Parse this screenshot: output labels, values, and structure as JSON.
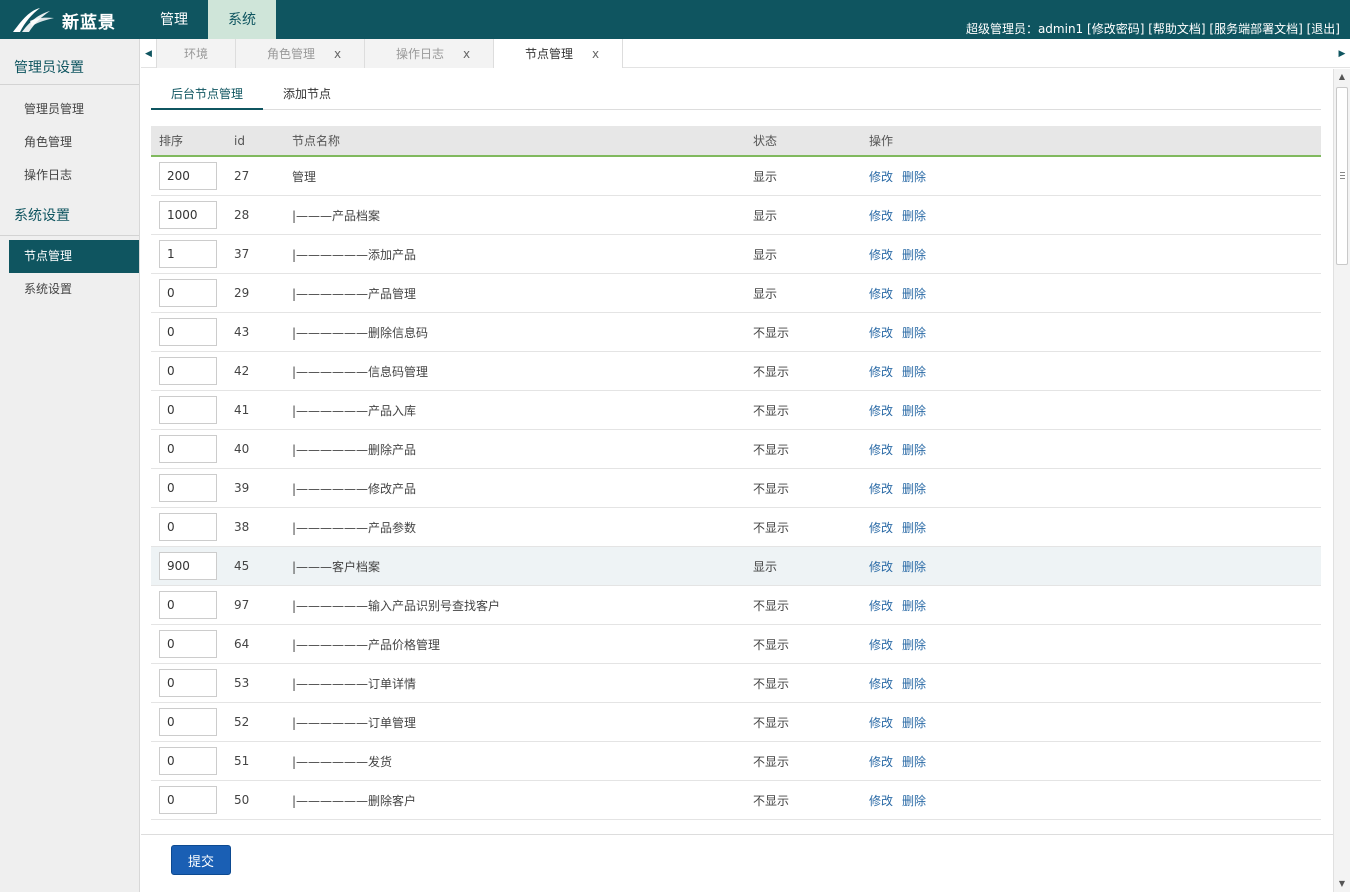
{
  "app": {
    "logo_text": "新蓝景",
    "top_nav": [
      {
        "label": "管理",
        "active": false
      },
      {
        "label": "系统",
        "active": true
      }
    ],
    "user_prefix": "超级管理员：",
    "username": "admin1",
    "user_links": [
      "[修改密码]",
      "[帮助文档]",
      "[服务端部署文档]",
      "[退出]"
    ]
  },
  "sidebar": {
    "groups": [
      {
        "title": "管理员设置",
        "items": [
          {
            "label": "管理员管理",
            "active": false
          },
          {
            "label": "角色管理",
            "active": false
          },
          {
            "label": "操作日志",
            "active": false
          }
        ]
      },
      {
        "title": "系统设置",
        "items": [
          {
            "label": "节点管理",
            "active": true
          },
          {
            "label": "系统设置",
            "active": false
          }
        ]
      }
    ]
  },
  "tabs": [
    {
      "label": "环境",
      "close": "",
      "active": false
    },
    {
      "label": "角色管理",
      "close": "x",
      "active": false
    },
    {
      "label": "操作日志",
      "close": "x",
      "active": false
    },
    {
      "label": "节点管理",
      "close": "x",
      "active": true
    }
  ],
  "subtabs": [
    {
      "label": "后台节点管理",
      "active": true
    },
    {
      "label": "添加节点",
      "active": false
    }
  ],
  "table": {
    "headers": [
      "排序",
      "id",
      "节点名称",
      "状态",
      "操作"
    ],
    "actions": {
      "edit": "修改",
      "delete": "删除"
    },
    "rows": [
      {
        "sort": "200",
        "id": "27",
        "name": "管理",
        "status": "显示"
      },
      {
        "sort": "1000",
        "id": "28",
        "name": "|———产品档案",
        "status": "显示"
      },
      {
        "sort": "1",
        "id": "37",
        "name": "|——————添加产品",
        "status": "显示"
      },
      {
        "sort": "0",
        "id": "29",
        "name": "|——————产品管理",
        "status": "显示"
      },
      {
        "sort": "0",
        "id": "43",
        "name": "|——————删除信息码",
        "status": "不显示"
      },
      {
        "sort": "0",
        "id": "42",
        "name": "|——————信息码管理",
        "status": "不显示"
      },
      {
        "sort": "0",
        "id": "41",
        "name": "|——————产品入库",
        "status": "不显示"
      },
      {
        "sort": "0",
        "id": "40",
        "name": "|——————删除产品",
        "status": "不显示"
      },
      {
        "sort": "0",
        "id": "39",
        "name": "|——————修改产品",
        "status": "不显示"
      },
      {
        "sort": "0",
        "id": "38",
        "name": "|——————产品参数",
        "status": "不显示"
      },
      {
        "sort": "900",
        "id": "45",
        "name": "|———客户档案",
        "status": "显示",
        "highlight": true
      },
      {
        "sort": "0",
        "id": "97",
        "name": "|——————输入产品识别号查找客户",
        "status": "不显示"
      },
      {
        "sort": "0",
        "id": "64",
        "name": "|——————产品价格管理",
        "status": "不显示"
      },
      {
        "sort": "0",
        "id": "53",
        "name": "|——————订单详情",
        "status": "不显示"
      },
      {
        "sort": "0",
        "id": "52",
        "name": "|——————订单管理",
        "status": "不显示"
      },
      {
        "sort": "0",
        "id": "51",
        "name": "|——————发货",
        "status": "不显示"
      },
      {
        "sort": "0",
        "id": "50",
        "name": "|——————删除客户",
        "status": "不显示"
      }
    ]
  },
  "footer": {
    "submit_label": "提交"
  },
  "colors": {
    "primary": "#0f5560",
    "accent_green": "#80b95e",
    "link": "#2a6aa6",
    "button": "#1a5fb4"
  }
}
